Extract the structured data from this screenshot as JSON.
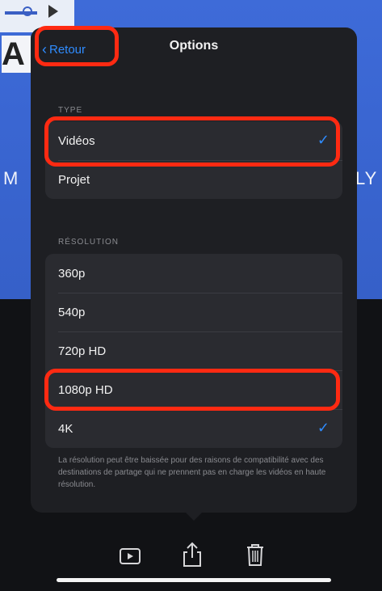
{
  "nav": {
    "back_label": "Retour",
    "title": "Options"
  },
  "type_section": {
    "header": "TYPE",
    "items": [
      {
        "label": "Vidéos",
        "selected": true
      },
      {
        "label": "Projet",
        "selected": false
      }
    ]
  },
  "resolution_section": {
    "header": "RÉSOLUTION",
    "items": [
      {
        "label": "360p",
        "selected": false
      },
      {
        "label": "540p",
        "selected": false
      },
      {
        "label": "720p HD",
        "selected": false
      },
      {
        "label": "1080p HD",
        "selected": false
      },
      {
        "label": "4K",
        "selected": true
      }
    ],
    "footer": "La résolution peut être baissée pour des raisons de compatibilité avec des destinations de partage qui ne prennent pas en charge les vidéos en haute résolution."
  },
  "checkmark_glyph": "✓",
  "toolbar": {
    "icons": [
      "play-icon",
      "share-icon",
      "trash-icon"
    ]
  },
  "colors": {
    "accent": "#2f8cff",
    "highlight": "#ff2a12",
    "popover_bg": "#1e1f23"
  }
}
